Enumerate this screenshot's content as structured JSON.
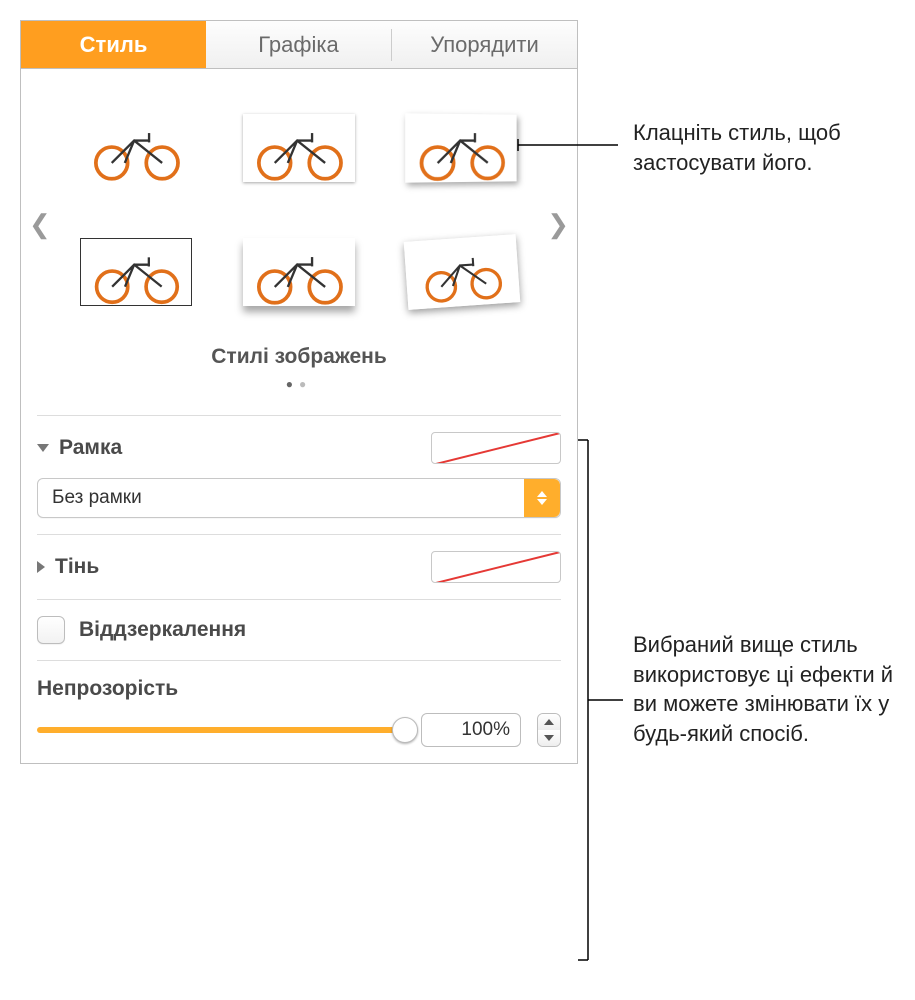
{
  "tabs": {
    "style": "Стиль",
    "image": "Графіка",
    "arrange": "Упорядити"
  },
  "styles_title": "Стилі зображень",
  "sections": {
    "border": {
      "label": "Рамка",
      "select": "Без рамки"
    },
    "shadow": {
      "label": "Тінь"
    },
    "reflection": {
      "label": "Віддзеркалення"
    },
    "opacity": {
      "label": "Непрозорість",
      "value": "100%"
    }
  },
  "callouts": {
    "apply": "Клацніть стиль, щоб застосувати його.",
    "effects": "Вибраний вище стиль використовує ці ефекти й ви можете змінювати їх у будь-який спосіб."
  }
}
